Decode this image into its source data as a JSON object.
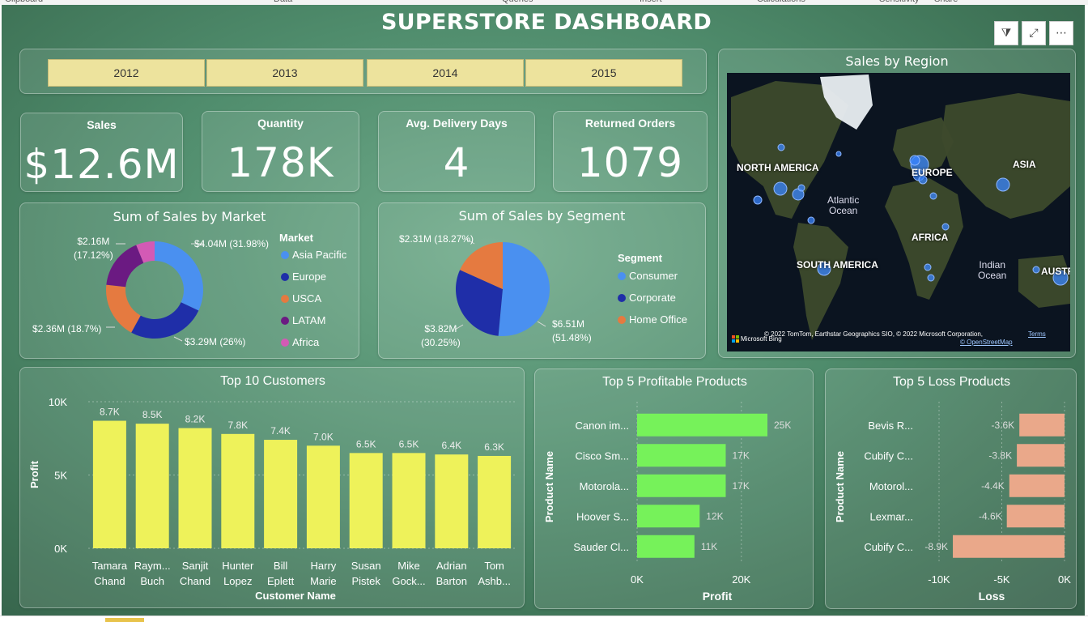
{
  "ribbon": [
    "Clipboard",
    "Data",
    "Queries",
    "Insert",
    "Calculations",
    "Sensitivity",
    "Share"
  ],
  "title": "SUPERSTORE DASHBOARD",
  "top_icons": [
    {
      "name": "filter-icon",
      "glyph": "⧩"
    },
    {
      "name": "focus-mode-icon",
      "glyph": "⤢"
    },
    {
      "name": "more-options-icon",
      "glyph": "⋯"
    }
  ],
  "years": [
    "2012",
    "2013",
    "2014",
    "2015"
  ],
  "kpis": [
    {
      "label": "Sales",
      "value": "$12.6M"
    },
    {
      "label": "Quantity",
      "value": "178K"
    },
    {
      "label": "Avg. Delivery Days",
      "value": "4"
    },
    {
      "label": "Returned Orders",
      "value": "1079"
    }
  ],
  "market": {
    "title": "Sum of Sales by Market",
    "legend_title": "Market",
    "items": [
      {
        "name": "Asia Pacific",
        "color": "#4a90f0",
        "label": "$4.04M (31.98%)",
        "pct": 31.98
      },
      {
        "name": "Europe",
        "color": "#1f2ea8",
        "label": "$3.29M (26%)",
        "pct": 26.0
      },
      {
        "name": "USCA",
        "color": "#e57a40",
        "label": "$2.36M (18.7%)",
        "pct": 18.7
      },
      {
        "name": "LATAM",
        "color": "#6b1a82",
        "label_l1": "$2.16M",
        "label_l2": "(17.12%)",
        "pct": 17.12
      },
      {
        "name": "Africa",
        "color": "#d35ab5",
        "pct": 6.2
      }
    ]
  },
  "segment": {
    "title": "Sum of Sales by Segment",
    "legend_title": "Segment",
    "items": [
      {
        "name": "Consumer",
        "color": "#4a90f0",
        "label_l1": "$6.51M",
        "label_l2": "(51.48%)",
        "pct": 51.48
      },
      {
        "name": "Corporate",
        "color": "#1f2ea8",
        "label_l1": "$3.82M",
        "label_l2": "(30.25%)",
        "pct": 30.25
      },
      {
        "name": "Home Office",
        "color": "#e57a40",
        "label": "$2.31M (18.27%)",
        "pct": 18.27
      }
    ]
  },
  "region": {
    "title": "Sales by Region",
    "labels": [
      "NORTH AMERICA",
      "EUROPE",
      "ASIA",
      "AFRICA",
      "SOUTH AMERICA",
      "AUSTR"
    ],
    "oceans": [
      [
        "Atlantic",
        "Ocean"
      ],
      [
        "Indian",
        "Ocean"
      ]
    ],
    "attribution": "© 2022 TomTom, Earthstar Geographics SIO, © 2022 Microsoft Corporation,",
    "terms": "Terms",
    "osm": "© OpenStreetMap",
    "bing": "Microsoft Bing"
  },
  "chart_data": [
    {
      "type": "bar",
      "title": "Top 10 Customers",
      "xlabel": "Customer Name",
      "ylabel": "Profit",
      "ylim": [
        0,
        10000
      ],
      "yticks": [
        "0K",
        "5K",
        "10K"
      ],
      "categories": [
        [
          "Tamara",
          "Chand"
        ],
        [
          "Raym...",
          "Buch"
        ],
        [
          "Sanjit",
          "Chand"
        ],
        [
          "Hunter",
          "Lopez"
        ],
        [
          "Bill",
          "Eplett"
        ],
        [
          "Harry",
          "Marie"
        ],
        [
          "Susan",
          "Pistek"
        ],
        [
          "Mike",
          "Gock..."
        ],
        [
          "Adrian",
          "Barton"
        ],
        [
          "Tom",
          "Ashb..."
        ]
      ],
      "values": [
        8700,
        8500,
        8200,
        7800,
        7400,
        7000,
        6500,
        6500,
        6400,
        6300
      ],
      "data_labels": [
        "8.7K",
        "8.5K",
        "8.2K",
        "7.8K",
        "7.4K",
        "7.0K",
        "6.5K",
        "6.5K",
        "6.4K",
        "6.3K"
      ],
      "color": "#eef25a",
      "grid": true
    },
    {
      "type": "bar",
      "orientation": "horizontal",
      "title": "Top 5 Profitable Products",
      "xlabel": "Profit",
      "ylabel": "Product Name",
      "xlim": [
        0,
        25000
      ],
      "xticks": [
        "0K",
        "20K"
      ],
      "categories": [
        "Canon im...",
        "Cisco Sm...",
        "Motorola...",
        "Hoover S...",
        "Sauder Cl..."
      ],
      "values": [
        25000,
        17000,
        17000,
        12000,
        11000
      ],
      "data_labels": [
        "25K",
        "17K",
        "17K",
        "12K",
        "11K"
      ],
      "color": "#76f25a"
    },
    {
      "type": "bar",
      "orientation": "horizontal",
      "title": "Top 5 Loss Products",
      "xlabel": "Loss",
      "ylabel": "Product Name",
      "xlim": [
        -10000,
        0
      ],
      "xticks": [
        "-10K",
        "-5K",
        "0K"
      ],
      "categories": [
        "Bevis R...",
        "Cubify C...",
        "Motorol...",
        "Lexmar...",
        "Cubify C..."
      ],
      "values": [
        -3600,
        -3800,
        -4400,
        -4600,
        -8900
      ],
      "data_labels": [
        "-3.6K",
        "-3.8K",
        "-4.4K",
        "-4.6K",
        "-8.9K"
      ],
      "color": "#eaa88a"
    }
  ]
}
